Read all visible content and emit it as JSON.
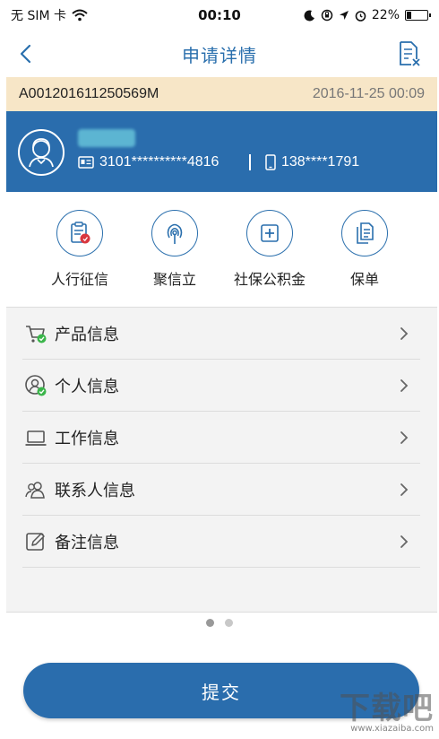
{
  "status_bar": {
    "carrier": "无 SIM 卡",
    "time": "00:10",
    "battery": "22%",
    "battery_level": 0.22
  },
  "nav": {
    "title": "申请详情"
  },
  "order": {
    "id": "A001201611250569M",
    "datetime": "2016-11-25 00:09"
  },
  "profile": {
    "id_number": "3101**********4816",
    "phone": "138****1791"
  },
  "quick_links": [
    {
      "label": "人行征信",
      "icon": "credit-report-icon"
    },
    {
      "label": "聚信立",
      "icon": "fingerprint-icon"
    },
    {
      "label": "社保公积金",
      "icon": "medical-cross-icon"
    },
    {
      "label": "保单",
      "icon": "documents-icon"
    }
  ],
  "sections": [
    {
      "label": "产品信息",
      "icon": "cart-check-icon"
    },
    {
      "label": "个人信息",
      "icon": "person-check-icon"
    },
    {
      "label": "工作信息",
      "icon": "laptop-icon"
    },
    {
      "label": "联系人信息",
      "icon": "contacts-icon"
    },
    {
      "label": "备注信息",
      "icon": "edit-note-icon"
    }
  ],
  "pager": {
    "total": 2,
    "current": 1
  },
  "submit_label": "提交",
  "watermark": {
    "main": "下载吧",
    "sub": "www.xiazaiba.com"
  },
  "colors": {
    "primary": "#2a6dad",
    "order_bar": "#f7e6c7",
    "check_green": "#3ab54a",
    "badge_red": "#d9363e"
  }
}
